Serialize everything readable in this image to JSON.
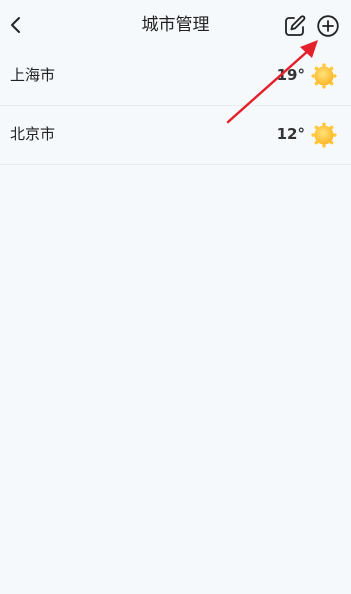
{
  "header": {
    "title": "城市管理",
    "back_icon": "chevron-left-icon",
    "edit_icon": "edit-icon",
    "add_icon": "plus-circle-icon"
  },
  "cities": [
    {
      "name": "上海市",
      "temp": "19°",
      "weather_icon": "sun-icon"
    },
    {
      "name": "北京市",
      "temp": "12°",
      "weather_icon": "sun-icon"
    }
  ],
  "colors": {
    "background": "#f5f9fc",
    "sun": "#ffc83d",
    "annotation_arrow": "#e4202a"
  }
}
